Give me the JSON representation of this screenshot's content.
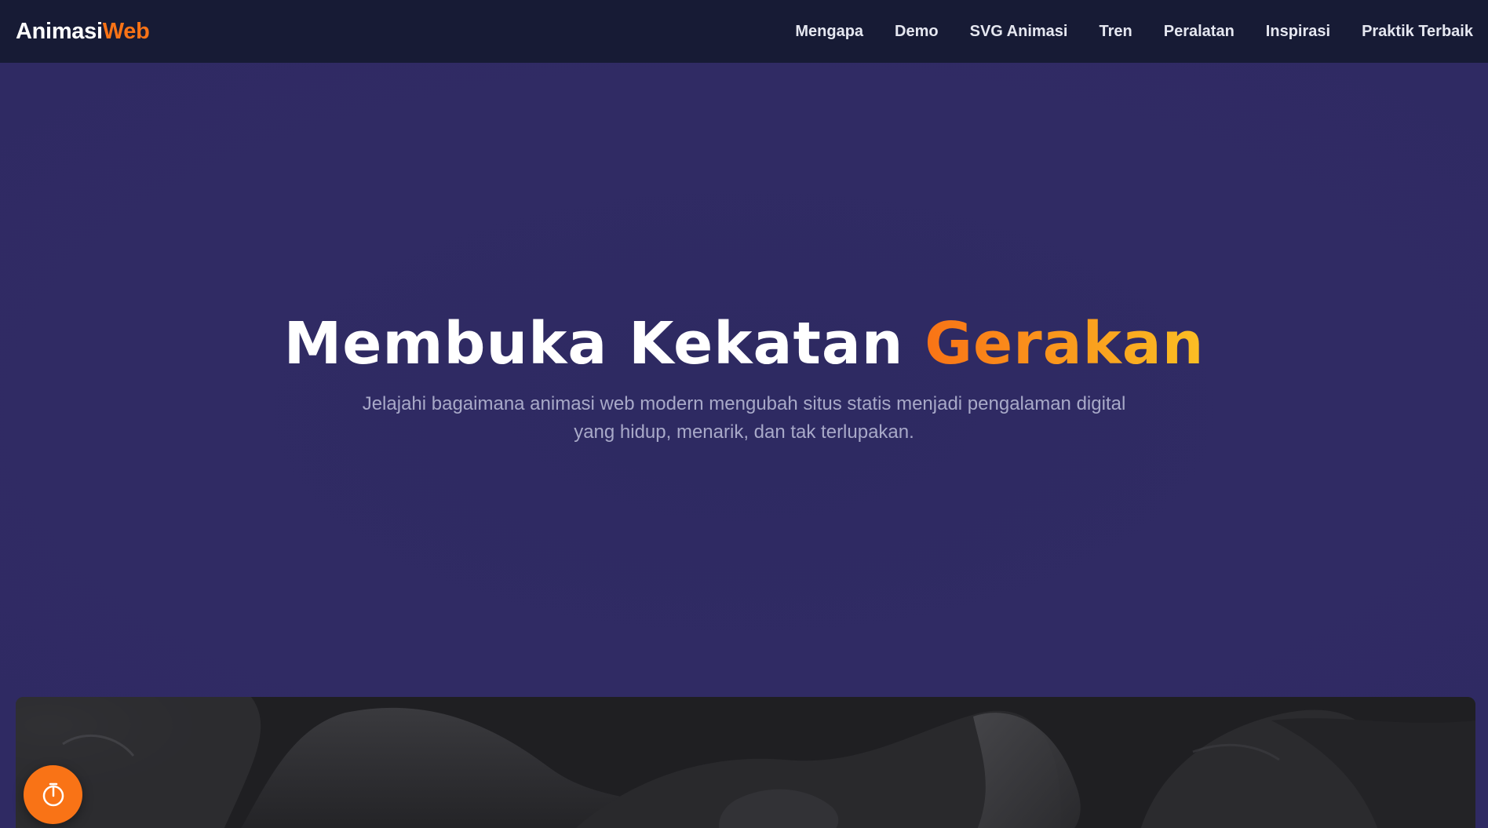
{
  "brand": {
    "part1": "Animasi",
    "part2": "Web"
  },
  "nav": {
    "items": [
      {
        "label": "Mengapa"
      },
      {
        "label": "Demo"
      },
      {
        "label": "SVG Animasi"
      },
      {
        "label": "Tren"
      },
      {
        "label": "Peralatan"
      },
      {
        "label": "Inspirasi"
      },
      {
        "label": "Praktik Terbaik"
      }
    ]
  },
  "hero": {
    "title_main": "Membuka Kekatan ",
    "title_accent": "Gerakan",
    "subtitle": "Jelajahi bagaimana animasi web modern mengubah situs statis menjadi pengalaman digital yang hidup, menarik, dan tak terlupakan."
  },
  "media": {
    "icon": "rocky-landscape-image"
  },
  "fab": {
    "icon": "timer-icon"
  },
  "colors": {
    "nav_bg": "#171b35",
    "hero_bg": "#2f2a63",
    "accent": "#f97316",
    "accent_gradient_end": "#fbbf24"
  }
}
